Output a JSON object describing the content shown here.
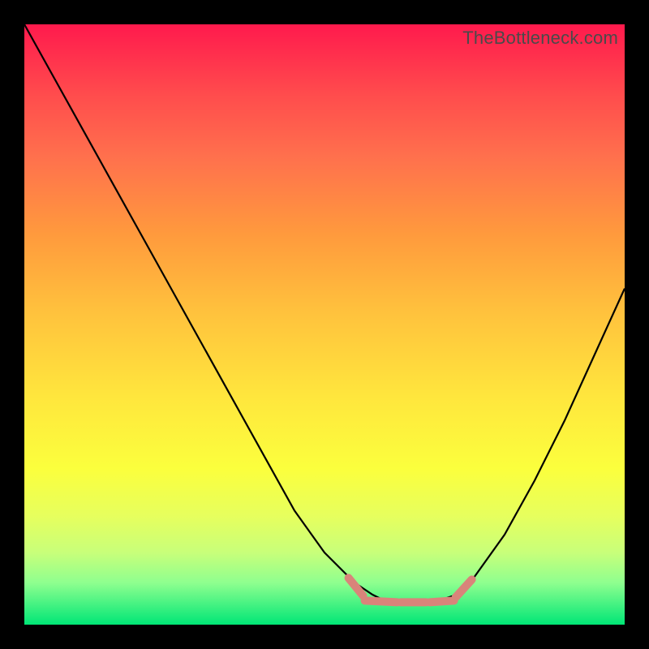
{
  "watermark": "TheBottleneck.com",
  "colors": {
    "frame_bg_top": "#ff1a4d",
    "frame_bg_bottom": "#00e676",
    "curve": "#000000",
    "flat_segment": "#d9847a",
    "page_bg": "#000000"
  },
  "chart_data": {
    "type": "line",
    "title": "",
    "xlabel": "",
    "ylabel": "",
    "xlim": [
      0,
      100
    ],
    "ylim": [
      0,
      100
    ],
    "grid": false,
    "note": "V-shaped bottleneck curve. Y-axis inverted visually: 0 = top (worst), 100 = bottom (best/green). Flat optimal region around x≈58–72.",
    "x": [
      0,
      5,
      10,
      15,
      20,
      25,
      30,
      35,
      40,
      45,
      50,
      55,
      58,
      60,
      63,
      66,
      69,
      72,
      75,
      80,
      85,
      90,
      95,
      100
    ],
    "y": [
      0,
      9,
      18,
      27,
      36,
      45,
      54,
      63,
      72,
      81,
      88,
      93,
      95,
      96,
      96.5,
      96.5,
      96,
      95,
      92,
      85,
      76,
      66,
      55,
      44
    ],
    "flat_region": {
      "x_start": 54,
      "x_end": 74,
      "y": 96
    }
  }
}
